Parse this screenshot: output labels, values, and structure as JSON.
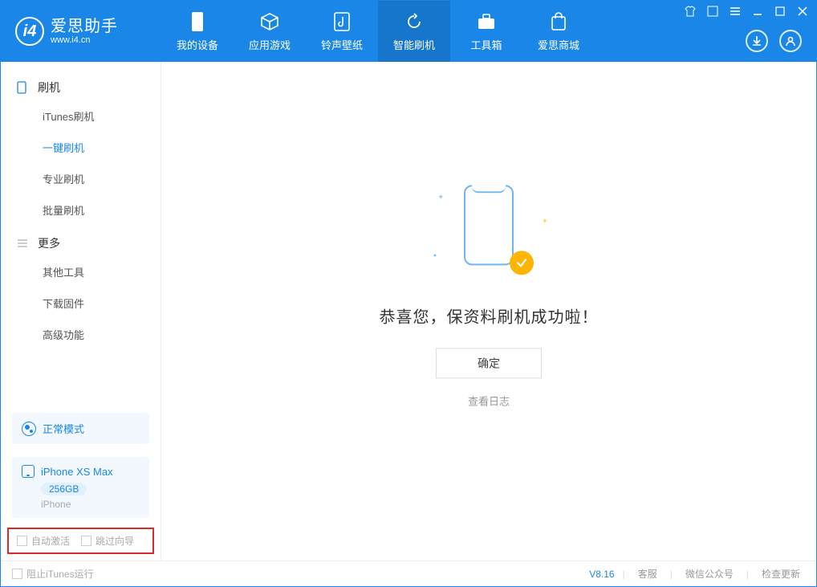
{
  "app": {
    "title": "爱思助手",
    "subtitle": "www.i4.cn"
  },
  "window_controls": {
    "tshirt": "tshirt-icon",
    "skin": "skin-icon",
    "menu": "menu-icon",
    "min": "minimize-icon",
    "max": "maximize-icon",
    "close": "close-icon"
  },
  "header_buttons": {
    "download": "download-icon",
    "user": "user-icon"
  },
  "nav": [
    {
      "label": "我的设备",
      "icon": "device-icon"
    },
    {
      "label": "应用游戏",
      "icon": "cube-icon"
    },
    {
      "label": "铃声壁纸",
      "icon": "music-icon"
    },
    {
      "label": "智能刷机",
      "icon": "refresh-icon",
      "active": true
    },
    {
      "label": "工具箱",
      "icon": "toolbox-icon"
    },
    {
      "label": "爱思商城",
      "icon": "shop-icon"
    }
  ],
  "sidebar": {
    "group1": {
      "label": "刷机",
      "items": [
        {
          "label": "iTunes刷机"
        },
        {
          "label": "一键刷机",
          "active": true
        },
        {
          "label": "专业刷机"
        },
        {
          "label": "批量刷机"
        }
      ]
    },
    "group2": {
      "label": "更多",
      "items": [
        {
          "label": "其他工具"
        },
        {
          "label": "下载固件"
        },
        {
          "label": "高级功能"
        }
      ]
    }
  },
  "mode": {
    "label": "正常模式"
  },
  "device": {
    "name": "iPhone XS Max",
    "storage": "256GB",
    "type": "iPhone"
  },
  "checkboxes": {
    "auto_activate": "自动激活",
    "skip_wizard": "跳过向导"
  },
  "main": {
    "success_message": "恭喜您，保资料刷机成功啦！",
    "ok_button": "确定",
    "view_log": "查看日志"
  },
  "footer": {
    "block_itunes": "阻止iTunes运行",
    "version": "V8.16",
    "links": [
      "客服",
      "微信公众号",
      "检查更新"
    ]
  }
}
